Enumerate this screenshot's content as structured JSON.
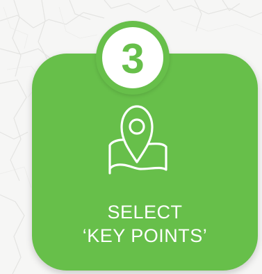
{
  "step": {
    "number": "3",
    "line1": "SELECT",
    "line2": "‘KEY POINTS’",
    "icon": "map-pin-icon"
  },
  "colors": {
    "accent": "#67bf4a",
    "badge_background": "#ffffff",
    "text": "#ffffff",
    "page_background": "#f6f6f5"
  }
}
